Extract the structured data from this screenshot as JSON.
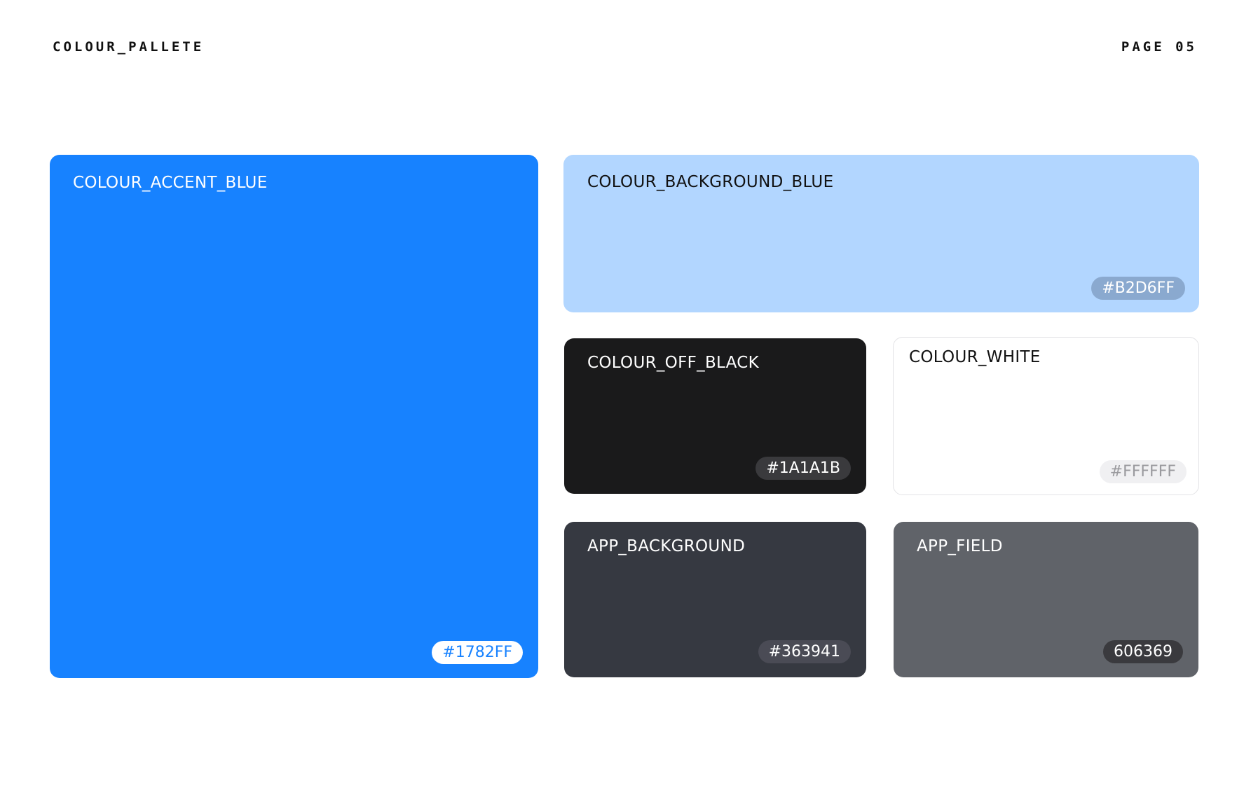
{
  "header": {
    "title": "COLOUR_PALLETE",
    "page": "PAGE 05"
  },
  "swatches": [
    {
      "name": "COLOUR_ACCENT_BLUE",
      "hex_label": "#1782FF",
      "color": "#1782FF"
    },
    {
      "name": "COLOUR_BACKGROUND_BLUE",
      "hex_label": "#B2D6FF",
      "color": "#B2D6FF"
    },
    {
      "name": "COLOUR_OFF_BLACK",
      "hex_label": "#1A1A1B",
      "color": "#1A1A1B"
    },
    {
      "name": "COLOUR_WHITE",
      "hex_label": "#FFFFFF",
      "color": "#FFFFFF"
    },
    {
      "name": "APP_BACKGROUND",
      "hex_label": "#363941",
      "color": "#363941"
    },
    {
      "name": "APP_FIELD",
      "hex_label": "606369",
      "color": "#606369"
    }
  ]
}
